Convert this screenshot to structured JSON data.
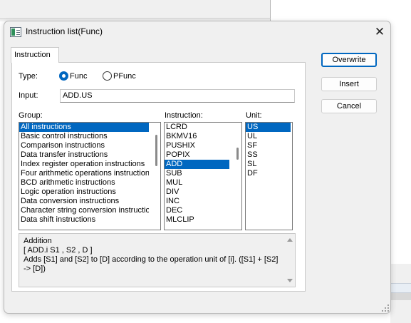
{
  "window": {
    "title": "Instruction list(Func)"
  },
  "tab": {
    "label": "Instruction"
  },
  "type": {
    "label": "Type:",
    "options": [
      {
        "label": "Func",
        "checked": true
      },
      {
        "label": "PFunc",
        "checked": false
      }
    ]
  },
  "input": {
    "label": "Input:",
    "value": "ADD.US"
  },
  "group": {
    "label": "Group:",
    "items": [
      "All instructions",
      "Basic control instructions",
      "Comparison instructions",
      "Data transfer instructions",
      "Index register operation instructions",
      "Four arithmetic operations instructions",
      "BCD arithmetic instructions",
      "Logic operation instructions",
      "Data conversion instructions",
      "Character string conversion instructions",
      "Data shift instructions"
    ],
    "selected": "All instructions"
  },
  "instruction": {
    "label": "Instruction:",
    "items": [
      "LCRD",
      "BKMV16",
      "PUSHIX",
      "POPIX",
      "ADD",
      "SUB",
      "MUL",
      "DIV",
      "INC",
      "DEC",
      "MLCLIP"
    ],
    "selected": "ADD"
  },
  "unit": {
    "label": "Unit:",
    "items": [
      "US",
      "UL",
      "SF",
      "SS",
      "SL",
      "DF"
    ],
    "selected": "US"
  },
  "description": {
    "line1": "Addition",
    "line2": "[ ADD.i  S1 , S2 , D ]",
    "line3": "Adds [S1] and [S2] to [D] according to the operation unit of [i]. ([S1] + [S2] -> [D])"
  },
  "buttons": {
    "overwrite": "Overwrite",
    "insert": "Insert",
    "cancel": "Cancel"
  },
  "colors": {
    "selection": "#0067c0",
    "dialog_bg": "#f0f0f0",
    "panel_bg": "#ffffff"
  }
}
